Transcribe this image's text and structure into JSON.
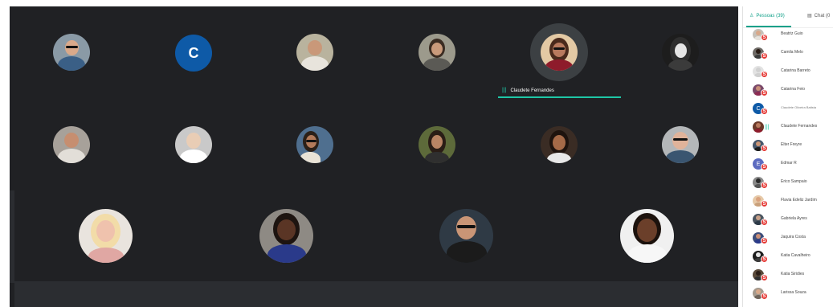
{
  "meeting": {
    "active_speaker": {
      "name": "Claudete Fernandes",
      "indicator": "|||"
    },
    "grid_letter_tile": "C"
  },
  "panel": {
    "tabs": [
      {
        "label": "Pessoas (39)",
        "icon": "people-icon",
        "active": true
      },
      {
        "label": "Chat (0",
        "icon": "chat-icon",
        "active": false
      }
    ],
    "badge_letter": "S",
    "participants": [
      {
        "name": "Beatriz Guio"
      },
      {
        "name": "Camila Melo"
      },
      {
        "name": "Catarina Barreto"
      },
      {
        "name": "Catarina Feio"
      },
      {
        "name": "Claudete Oliveira Batista",
        "letter": "C"
      },
      {
        "name": "Claudete Fernandes",
        "speaking": true
      },
      {
        "name": "Elter Freyre"
      },
      {
        "name": "Edmar R",
        "letter": "E"
      },
      {
        "name": "Erico Sampaio"
      },
      {
        "name": "Flavia Edeliz Jardim"
      },
      {
        "name": "Gabriela Ayres"
      },
      {
        "name": "Jaquira Costa"
      },
      {
        "name": "Katia Cavalheiro"
      },
      {
        "name": "Katia Siridies"
      },
      {
        "name": "Larissa Souza"
      }
    ]
  },
  "colors": {
    "stage_bg": "#202124",
    "accent": "#1ec7a6",
    "badge": "#e53935",
    "letter_avatar": "#0e5aa7"
  }
}
